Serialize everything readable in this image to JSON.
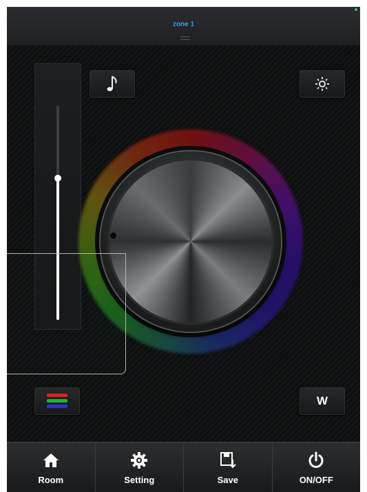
{
  "header": {
    "title": "zone 1"
  },
  "mode_buttons": {
    "play_icon": "play-icon",
    "music_icon": "music-note-icon",
    "brightness_icon": "sun-icon"
  },
  "brightness": {
    "level_fraction": 0.66
  },
  "color_wheel": {
    "ring_colors": [
      "#7a1111",
      "#4a1070",
      "#1a2a70",
      "#1a6a1a",
      "#6a5a10"
    ]
  },
  "rgb_button": {
    "icon": "rgb-bars-icon",
    "colors": [
      "#e02020",
      "#20b040",
      "#3030d0"
    ]
  },
  "white_button": {
    "label": "W"
  },
  "tabs": [
    {
      "label": "Room",
      "icon": "home-icon"
    },
    {
      "label": "Setting",
      "icon": "gear-icon"
    },
    {
      "label": "Save",
      "icon": "save-icon"
    },
    {
      "label": "ON/OFF",
      "icon": "power-icon"
    }
  ]
}
